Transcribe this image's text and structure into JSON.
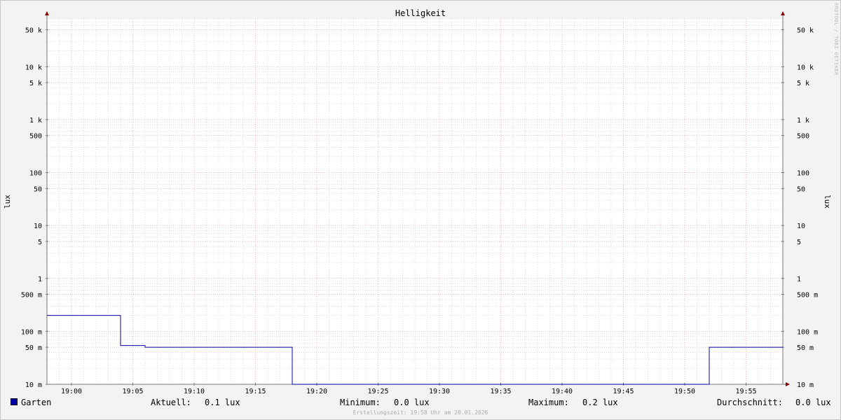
{
  "chart_data": {
    "type": "line",
    "title": "Helligkeit",
    "ylabel": "lux",
    "yscale": "log",
    "ylim": [
      0.01,
      80000
    ],
    "xlim": [
      "18:58",
      "19:58"
    ],
    "x_tick_labels": [
      "19:00",
      "19:05",
      "19:10",
      "19:15",
      "19:20",
      "19:25",
      "19:30",
      "19:35",
      "19:40",
      "19:45",
      "19:50",
      "19:55"
    ],
    "y_tick_labels": [
      {
        "value": 0.01,
        "label": "10 m"
      },
      {
        "value": 0.05,
        "label": "50 m"
      },
      {
        "value": 0.1,
        "label": "100 m"
      },
      {
        "value": 0.5,
        "label": "500 m"
      },
      {
        "value": 1,
        "label": "1"
      },
      {
        "value": 5,
        "label": "5"
      },
      {
        "value": 10,
        "label": "10"
      },
      {
        "value": 50,
        "label": "50"
      },
      {
        "value": 100,
        "label": "100"
      },
      {
        "value": 500,
        "label": "500"
      },
      {
        "value": 1000,
        "label": "1 k"
      },
      {
        "value": 5000,
        "label": "5 k"
      },
      {
        "value": 10000,
        "label": "10 k"
      },
      {
        "value": 50000,
        "label": "50 k"
      }
    ],
    "grid": true,
    "series": [
      {
        "name": "Garten",
        "color": "#0000aa",
        "step": true,
        "points": [
          {
            "x": "18:58",
            "y": 0.2
          },
          {
            "x": "19:04",
            "y": 0.054
          },
          {
            "x": "19:06",
            "y": 0.05
          },
          {
            "x": "19:18",
            "y": 0.01
          },
          {
            "x": "19:52",
            "y": 0.05
          },
          {
            "x": "19:58",
            "y": 0.05
          }
        ]
      }
    ]
  },
  "legend": {
    "series_name": "Garten",
    "swatch_color": "#0000aa",
    "current_label": "Aktuell:",
    "current_value": "0.1 lux",
    "min_label": "Minimum:",
    "min_value": "0.0 lux",
    "max_label": "Maximum:",
    "max_value": "0.2 lux",
    "avg_label": "Durchschnitt:",
    "avg_value": "0.0 lux"
  },
  "footer": "Erstellungszeit: 19:58 Uhr am 20.01.2026",
  "watermark": "RRDTOOL / TOBI OETIKER",
  "colors": {
    "line": "#0000aa",
    "major_grid": "#e8a0a0",
    "minor_grid": "#c8c8c8",
    "axis": "#777777",
    "arrow": "#880000"
  }
}
